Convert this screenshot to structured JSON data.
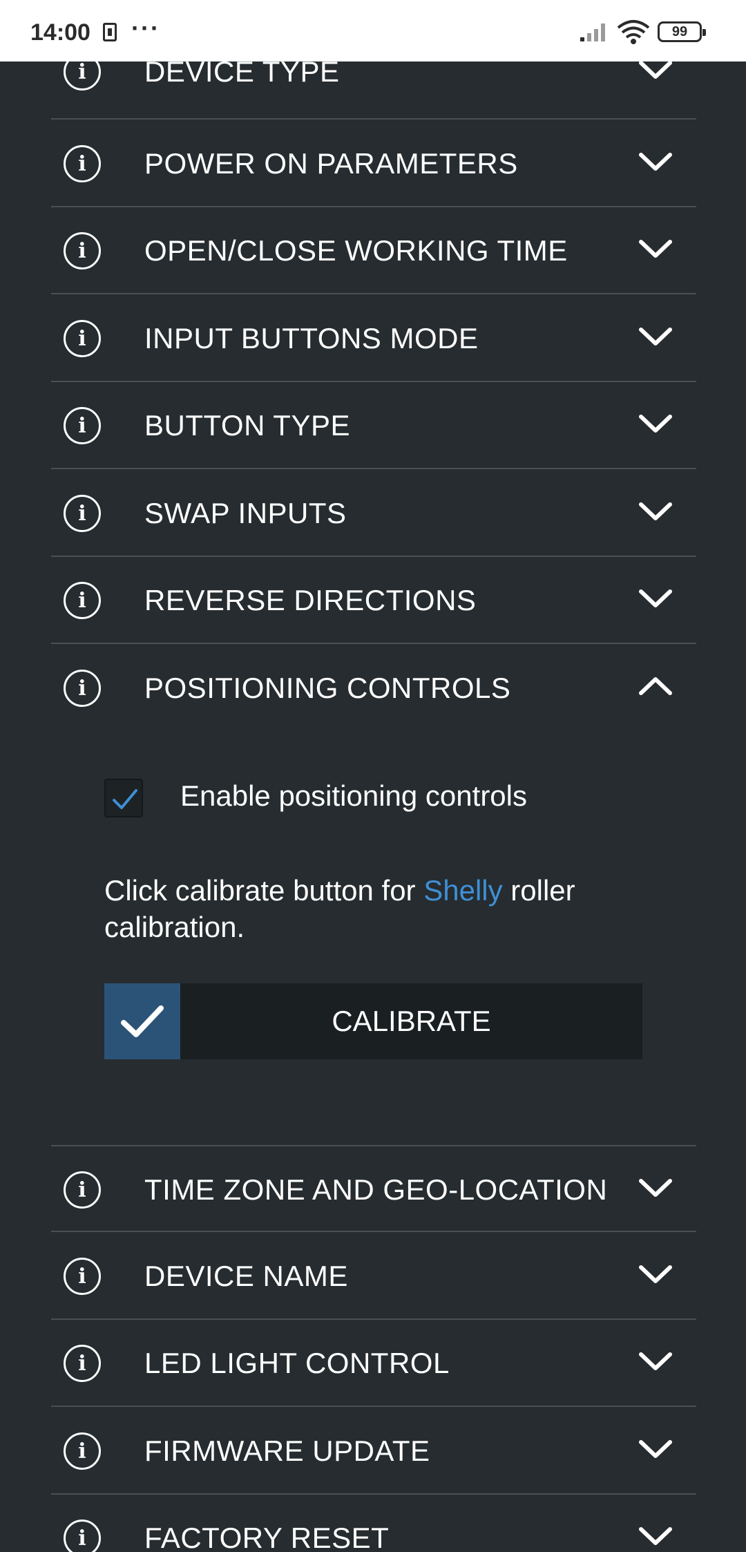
{
  "status_bar": {
    "time": "14:00",
    "dots": "···",
    "battery": "99"
  },
  "sections_top": [
    {
      "label": "DEVICE TYPE",
      "expanded": false
    },
    {
      "label": "POWER ON PARAMETERS",
      "expanded": false
    },
    {
      "label": "OPEN/CLOSE WORKING TIME",
      "expanded": false
    },
    {
      "label": "INPUT BUTTONS MODE",
      "expanded": false
    },
    {
      "label": "BUTTON TYPE",
      "expanded": false
    },
    {
      "label": "SWAP INPUTS",
      "expanded": false
    },
    {
      "label": "REVERSE DIRECTIONS",
      "expanded": false
    },
    {
      "label": "POSITIONING CONTROLS",
      "expanded": true
    }
  ],
  "positioning_panel": {
    "checkbox_label": "Enable positioning controls",
    "checkbox_checked": true,
    "text_before": "Click calibrate button for ",
    "text_brand": "Shelly",
    "text_after": " roller calibration.",
    "calibrate_button": "CALIBRATE"
  },
  "sections_bottom": [
    {
      "label": "TIME ZONE AND GEO-LOCATION",
      "expanded": false
    },
    {
      "label": "DEVICE NAME",
      "expanded": false
    },
    {
      "label": "LED LIGHT CONTROL",
      "expanded": false
    },
    {
      "label": "FIRMWARE UPDATE",
      "expanded": false
    },
    {
      "label": "FACTORY RESET",
      "expanded": false
    }
  ],
  "colors": {
    "background": "#262c2f",
    "accent": "#3f8fd6",
    "calibrate_check_bg": "#2b5377",
    "divider": "#4a5154"
  },
  "icons": {
    "info": "info-circle-icon",
    "collapsed": "chevron-down-icon",
    "expanded": "chevron-up-icon"
  }
}
